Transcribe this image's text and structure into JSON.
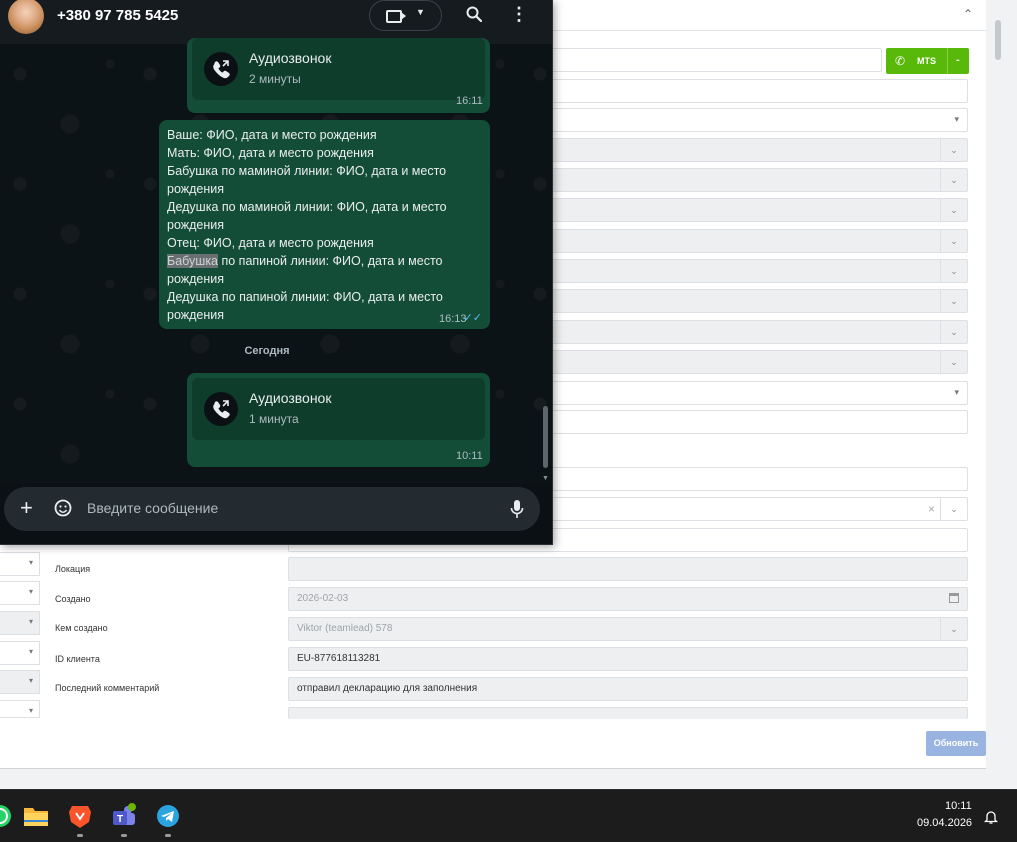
{
  "whatsapp": {
    "contact": "+380 97 785 5425",
    "messages": [
      {
        "type": "call",
        "title": "Аудиозвонок",
        "duration": "2 минуты",
        "time": "16:11"
      },
      {
        "type": "text",
        "time": "16:13",
        "lines": [
          "Ваше: ФИО, дата и место рождения",
          "Мать: ФИО, дата и место рождения",
          "Бабушка по маминой линии: ФИО, дата и место рождения",
          "Дедушка по маминой линии: ФИО, дата и место рождения",
          "Отец: ФИО, дата и место рождения",
          "Бабушка по папиной линии: ФИО, дата и место рождения",
          "Дедушка по папиной линии: ФИО, дата и место рождения"
        ],
        "highlight": "Бабушка"
      },
      {
        "type": "call",
        "title": "Аудиозвонок",
        "duration": "1 минута",
        "time": "10:11"
      }
    ],
    "day_separator": "Сегодня",
    "composer_placeholder": "Введите сообщение",
    "icons": [
      "video-call-icon",
      "chevron-down-icon",
      "search-icon",
      "menu-icon",
      "phone-call-icon",
      "plus-icon",
      "sticker-icon",
      "mic-icon"
    ]
  },
  "crm": {
    "call_button": {
      "label": "MTS",
      "dropdown": "-"
    },
    "fields": {
      "location_label": "Локация",
      "created_label": "Создано",
      "created_value": "2026-02-03",
      "created_by_label": "Кем создано",
      "created_by_value": "Viktor (teamlead) 578",
      "client_id_label": "ID клиента",
      "client_id_value": "EU-877618113281",
      "last_comment_label": "Последний комментарий",
      "last_comment_value": "отправил декларацию для заполнения"
    },
    "update_button": "Обновить",
    "accent": "#58b90a",
    "update_color": "#9ab4e2"
  },
  "taskbar": {
    "apps": [
      "whatsapp-icon",
      "file-explorer-icon",
      "brave-icon",
      "teams-icon",
      "telegram-icon"
    ],
    "time": "10:11",
    "date": "09.04.2026"
  }
}
